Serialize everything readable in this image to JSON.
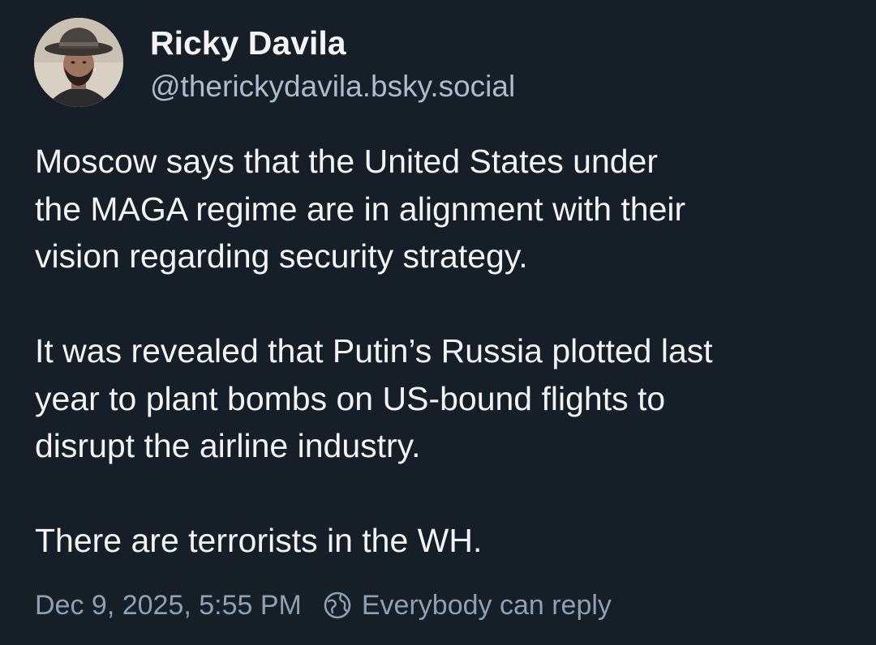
{
  "author": {
    "display_name": "Ricky Davila",
    "handle": "@therickydavila.bsky.social"
  },
  "post": {
    "paragraphs": [
      "Moscow says that the United States under\nthe MAGA regime are in alignment with their\nvision regarding security strategy.",
      "It was revealed that Putin’s Russia plotted last\nyear to plant bombs on US-bound flights to\ndisrupt the airline industry.",
      "There are terrorists in the WH."
    ],
    "timestamp": "Dec 9, 2025, 5:55 PM",
    "reply_setting": "Everybody can reply"
  },
  "icons": {
    "reply_setting_icon": "globe-icon"
  },
  "colors": {
    "background": "#161e27",
    "text": "#f1f3f5",
    "muted": "#aebbc9"
  }
}
